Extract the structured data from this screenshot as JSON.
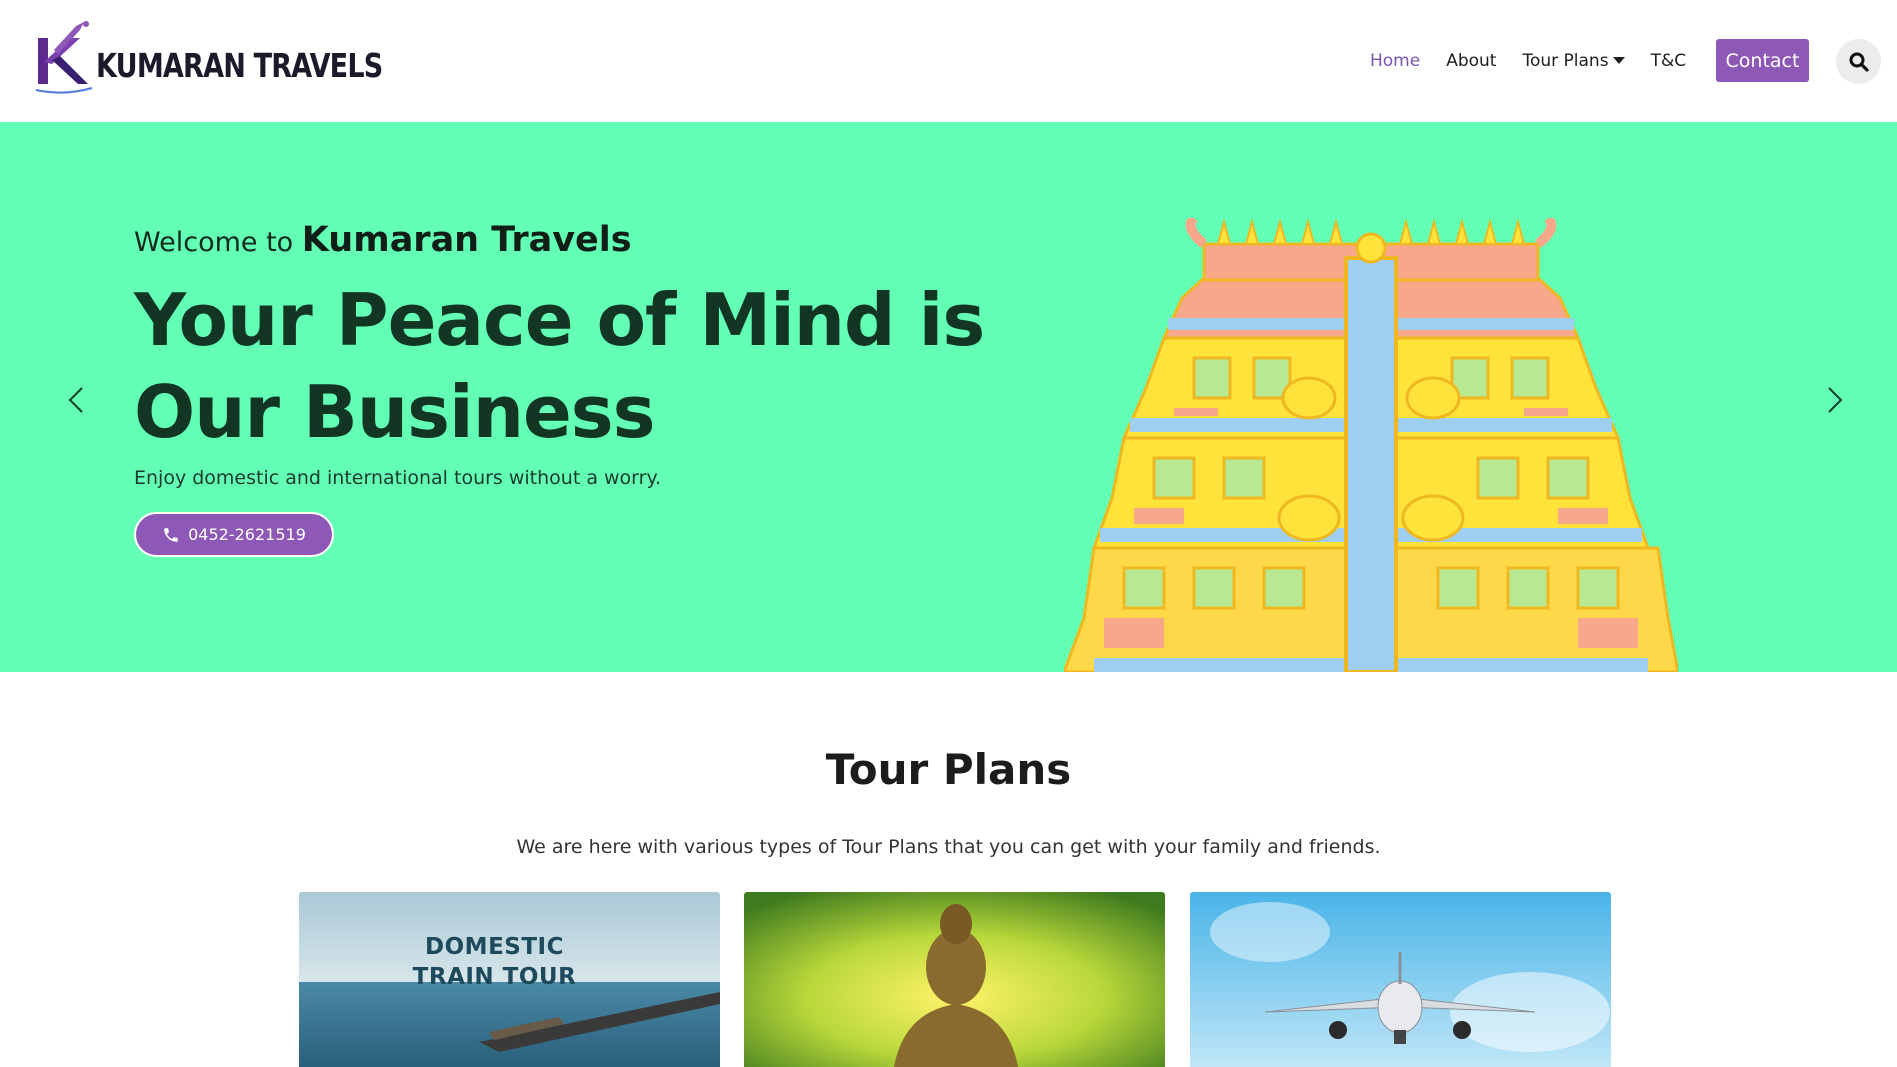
{
  "brand": {
    "logo_text": "KUMARAN TRAVELS",
    "accent_color": "#8e58b6",
    "hero_background": "#62ffb5"
  },
  "nav": {
    "items": [
      {
        "label": "Home",
        "active": true
      },
      {
        "label": "About",
        "active": false
      },
      {
        "label": "Tour Plans",
        "active": false,
        "dropdown": true
      },
      {
        "label": "T&C",
        "active": false
      }
    ],
    "contact_label": "Contact",
    "search_icon": "search-icon"
  },
  "hero": {
    "welcome_prefix": "Welcome to",
    "welcome_brand": "Kumaran Travels",
    "headline": "Your Peace of Mind is Our Business",
    "subline": "Enjoy domestic and international tours without a worry.",
    "phone": "0452-2621519",
    "phone_icon": "phone-icon",
    "prev_icon": "chevron-left-icon",
    "next_icon": "chevron-right-icon"
  },
  "tour_plans": {
    "title": "Tour Plans",
    "subtitle": "We are here with various types of Tour Plans that you can get with your family and friends.",
    "cards": [
      {
        "label_line1": "DOMESTIC",
        "label_line2": "TRAIN TOUR"
      },
      {
        "image": "buddha-statue-image"
      },
      {
        "image": "airplane-image"
      }
    ]
  }
}
